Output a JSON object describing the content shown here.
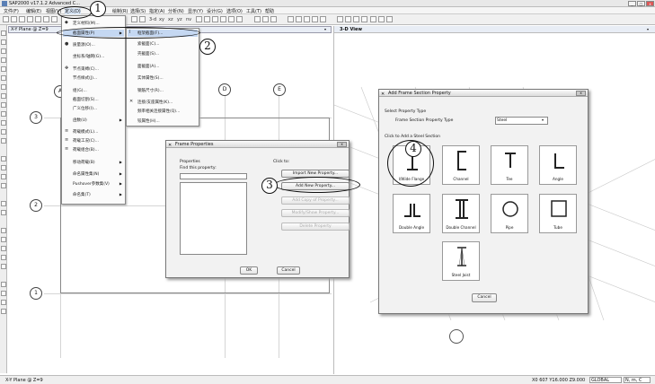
{
  "app": {
    "title": "SAP2000 v17.1.2 Advanced C...",
    "window_controls": [
      "_",
      "□",
      "x"
    ]
  },
  "menubar": {
    "items": [
      "文件(F)",
      "编辑(E)",
      "视图(V)",
      "定义(D)",
      "绘制(R)",
      "选择(S)",
      "指定(A)",
      "分析(N)",
      "显示(Y)",
      "设计(G)",
      "选项(O)",
      "工具(T)",
      "帮助"
    ]
  },
  "toolbar": {
    "text_items": [
      "3-d",
      "xy",
      "xz",
      "yz",
      "nv"
    ]
  },
  "panes": {
    "left_tab": "X-Y Plane @ Z=9",
    "right_tab": "3-D View"
  },
  "grid": {
    "col_bubbles": [
      "A",
      "D",
      "E"
    ],
    "row_bubbles": [
      "3",
      "2",
      "1"
    ]
  },
  "define_menu": {
    "items": [
      {
        "label": "定义材料(M)...",
        "icon": "material-icon",
        "submenu": false
      },
      {
        "label": "截面属性(P)",
        "icon": "",
        "submenu": true,
        "highlighted": true
      },
      {
        "label": "质量源(O)...",
        "icon": "mass-icon",
        "submenu": false
      },
      {
        "label": "坐标系/轴网(G)...",
        "icon": "",
        "submenu": false
      },
      {
        "label": "节点束缚(C)...",
        "icon": "joint-constraint-icon",
        "submenu": false
      },
      {
        "label": "节点样式(J)...",
        "icon": "",
        "submenu": false
      },
      {
        "label": "组(G)...",
        "icon": "",
        "submenu": false
      },
      {
        "label": "截面切割(S)...",
        "icon": "",
        "submenu": false
      },
      {
        "label": "广义位移(I)...",
        "icon": "",
        "submenu": false
      },
      {
        "label": "函数(U)",
        "icon": "",
        "submenu": true
      },
      {
        "label": "荷载模式(L)...",
        "icon": "load-pattern-icon",
        "submenu": false
      },
      {
        "label": "荷载工况(C)...",
        "icon": "load-case-icon",
        "submenu": false
      },
      {
        "label": "荷载组合(B)...",
        "icon": "load-combo-icon",
        "submenu": false
      },
      {
        "label": "移动荷载(B)",
        "icon": "",
        "submenu": true
      },
      {
        "label": "命名属性集(N)",
        "icon": "",
        "submenu": true
      },
      {
        "label": "Pushover参数集(V)",
        "icon": "",
        "submenu": true
      },
      {
        "label": "命名集(T)",
        "icon": "",
        "submenu": true
      }
    ]
  },
  "section_submenu": {
    "items": [
      {
        "label": "框架截面(F)...",
        "icon": "frame-section-icon"
      },
      {
        "label": "索截面(C)...",
        "icon": ""
      },
      {
        "label": "壳截面(S)...",
        "icon": ""
      },
      {
        "label": "面截面(A)...",
        "icon": ""
      },
      {
        "label": "实体属性(S)...",
        "icon": ""
      },
      {
        "label": "钢筋尺寸(R)...",
        "icon": ""
      },
      {
        "label": "连接/支座属性(K)...",
        "icon": "link-icon"
      },
      {
        "label": "频率相关连接属性(Q)...",
        "icon": ""
      },
      {
        "label": "铰属性(H)...",
        "icon": ""
      }
    ]
  },
  "callouts": [
    "1",
    "2",
    "3",
    "4"
  ],
  "frame_properties_dialog": {
    "title": "Frame Properties",
    "properties_label": "Properties",
    "find_label": "Find this property:",
    "click_to_label": "Click to:",
    "buttons": [
      {
        "label": "Import New Property...",
        "enabled": true
      },
      {
        "label": "Add New Property...",
        "enabled": true
      },
      {
        "label": "Add Copy of Property...",
        "enabled": false
      },
      {
        "label": "Modify/Show Property...",
        "enabled": false
      },
      {
        "label": "Delete Property",
        "enabled": false
      }
    ],
    "ok_label": "OK",
    "cancel_label": "Cancel"
  },
  "add_section_dialog": {
    "title": "Add Frame Section Property",
    "select_type_label": "Select Property Type",
    "type_label": "Frame Section Property Type",
    "type_value": "Steel",
    "click_add_label": "Click to Add a Steel Section",
    "sections": [
      {
        "label": "I/Wide Flange",
        "icon": "i-beam-icon"
      },
      {
        "label": "Channel",
        "icon": "channel-icon"
      },
      {
        "label": "Tee",
        "icon": "tee-icon"
      },
      {
        "label": "Angle",
        "icon": "angle-icon"
      },
      {
        "label": "Double Angle",
        "icon": "double-angle-icon"
      },
      {
        "label": "Double Channel",
        "icon": "double-channel-icon"
      },
      {
        "label": "Pipe",
        "icon": "pipe-icon"
      },
      {
        "label": "Tube",
        "icon": "tube-icon"
      },
      {
        "label": "Steel Joist",
        "icon": "steel-joist-icon"
      }
    ],
    "cancel_label": "Cancel"
  },
  "statusbar": {
    "left": "X-Y Plane @ Z=9",
    "coords": "X0 607  Y16.000  Z9.000",
    "coord_system": "GLOBAL",
    "units": "N, m, C"
  }
}
